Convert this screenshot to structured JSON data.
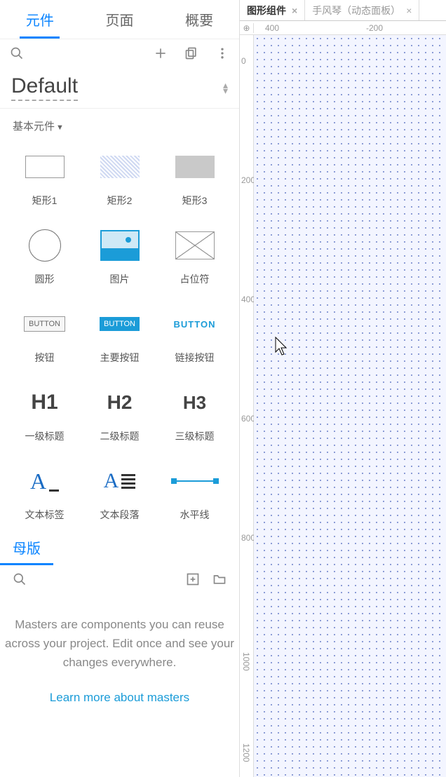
{
  "tabs": {
    "widgets": "元件",
    "pages": "页面",
    "overview": "概要"
  },
  "libraryName": "Default",
  "sectionBasic": "基本元件",
  "widgets": {
    "rect1": "矩形1",
    "rect2": "矩形2",
    "rect3": "矩形3",
    "circle": "圆形",
    "image": "图片",
    "placeholder": "占位符",
    "button": "按钮",
    "primaryBtn": "主要按钮",
    "linkBtn": "链接按钮",
    "h1": "一级标题",
    "h2": "二级标题",
    "h3": "三级标题",
    "textLabel": "文本标签",
    "textPara": "文本段落",
    "hr": "水平线",
    "btnSample": "BUTTON",
    "h1s": "H1",
    "h2s": "H2",
    "h3s": "H3"
  },
  "masters": {
    "title": "母版",
    "desc": "Masters are components you can reuse across your project. Edit once and see your changes everywhere.",
    "link": "Learn more about masters"
  },
  "fileTabs": {
    "active": "图形组件",
    "inactive": "手风琴（动态面板）"
  },
  "rulerH": {
    "t1": "400",
    "t2": "-200"
  },
  "rulerV": {
    "v0": "0",
    "v200": "200",
    "v400": "400",
    "v600": "600",
    "v800": "800",
    "v1000": "1000",
    "v1200": "1200"
  }
}
